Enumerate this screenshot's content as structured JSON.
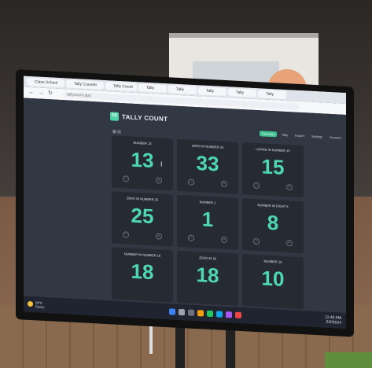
{
  "browser": {
    "tabs": [
      "Class School",
      "Tally Counter",
      "Tally Count",
      "Tally",
      "Tally",
      "Tally",
      "Tally",
      "Tally"
    ],
    "url": "tallycount.app"
  },
  "app": {
    "logo_letter": "TC",
    "title": "TALLY COUNT",
    "nav": [
      "Counters",
      "Tally",
      "Export",
      "Settings",
      "Account"
    ],
    "counters": [
      {
        "label": "Number 13",
        "value": "13"
      },
      {
        "label": "Zero in number 33",
        "value": "33"
      },
      {
        "label": "Lizard in number 15",
        "value": "15"
      },
      {
        "label": "Zero in number 25",
        "value": "25"
      },
      {
        "label": "Number 1",
        "value": "1"
      },
      {
        "label": "Number in eight 8",
        "value": "8"
      },
      {
        "label": "Number in number 18",
        "value": "18"
      },
      {
        "label": "Zero in 18",
        "value": "18"
      },
      {
        "label": "Number 10",
        "value": "10"
      }
    ]
  },
  "taskbar": {
    "weather_temp": "29°C",
    "weather_text": "Sunny",
    "clock_time": "11:40 AM",
    "clock_date": "2/2/2024"
  },
  "colors": {
    "accent": "#4ed6b5",
    "card_bg": "#252a33",
    "app_bg": "#313743"
  }
}
